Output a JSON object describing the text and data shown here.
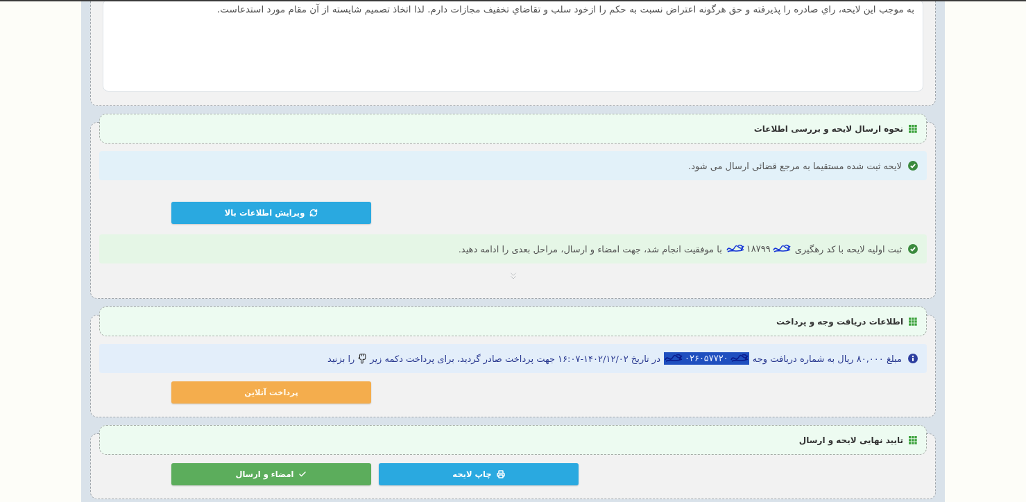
{
  "statement": {
    "value": "به موجب این لایحه، راي صادره را پذیرفته و حق هرگونه اعتراض نسبت به حکم را ازخود سلب و تقاضاي تخفیف مجازات دارم. لذا اتخاذ تصمیم شایسته از آن مقام مورد استدعاست."
  },
  "sections": [
    {
      "title": "نحوه ارسال لایحه و بررسی اطلاعات",
      "items": [
        {
          "kind": "info",
          "parts": [
            {
              "kind": "text",
              "text": "لایحه ثبت شده مستقیما به مرجع قضائی ارسال می شود."
            }
          ]
        },
        {
          "kind": "buttons",
          "buttons": [
            {
              "kind": "edit",
              "label": "ویرایش اطلاعات بالا"
            }
          ]
        },
        {
          "kind": "success",
          "parts": [
            {
              "kind": "text",
              "text": "ثبت اولیه لایحه با کد رهگیری"
            },
            {
              "kind": "code",
              "text": "۱۸۷۹۹",
              "highlighted": false,
              "redacted": true
            },
            {
              "kind": "text",
              "text": "با موفقیت انجام شد، جهت امضاء و ارسال، مراحل بعدی را ادامه دهید."
            }
          ]
        },
        {
          "kind": "expander",
          "expanded": false
        }
      ]
    },
    {
      "title": "اطلاعات دریافت وجه و پرداخت",
      "items": [
        {
          "kind": "notice",
          "parts": [
            {
              "kind": "text",
              "text": "مبلغ ۸۰,۰۰۰ ریال به شماره دریافت وجه"
            },
            {
              "kind": "code",
              "text": "۰۲۶۰۵۷۷۲۰",
              "highlighted": true,
              "redacted": true
            },
            {
              "kind": "text",
              "text": "در تاریخ ۱۴۰۲/۱۲/۰۲-۱۶:۰۷ جهت پرداخت صادر گردید، برای پرداخت دکمه زیر"
            },
            {
              "kind": "icon"
            },
            {
              "kind": "text",
              "text": "را بزنید"
            }
          ]
        },
        {
          "kind": "buttons",
          "buttons": [
            {
              "kind": "pay",
              "label": "پرداخت آنلاین"
            }
          ]
        }
      ]
    },
    {
      "title": "تایید نهایی لایحه و ارسال",
      "items": [
        {
          "kind": "buttons",
          "buttons": [
            {
              "kind": "print",
              "label": "چاپ لایحه"
            },
            {
              "kind": "sign",
              "label": "امضاء و ارسال"
            }
          ]
        }
      ]
    }
  ]
}
